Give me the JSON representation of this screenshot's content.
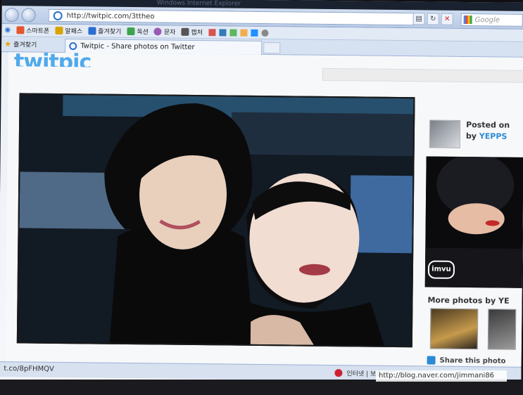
{
  "browser": {
    "title_text": "Windows Internet Explorer",
    "url": "http://twitpic.com/3ttheo",
    "search_placeholder": "Google",
    "links": [
      {
        "label": "스마트폰",
        "icon": "home-icon",
        "color": "#e4572e"
      },
      {
        "label": "알패스",
        "icon": "key-icon",
        "color": "#d9a400"
      },
      {
        "label": "즐겨찾기",
        "icon": "star-icon",
        "color": "#2a6fd0"
      },
      {
        "label": "옥션",
        "icon": "auction-icon",
        "color": "#3fa34d"
      },
      {
        "label": "문자",
        "icon": "chat-icon",
        "color": "#9b59b6"
      },
      {
        "label": "캡처",
        "icon": "capture-icon",
        "color": "#555555"
      }
    ],
    "favorites_label": "즐겨찾기",
    "tab_title": "Twitpic - Share photos on Twitter",
    "status_url": "t.co/8pFHMQV",
    "status_zone": "인터넷 | 보호 모드: 켜짐"
  },
  "page": {
    "logo_text": "twitpic",
    "posted_on": "Posted on",
    "by_label": "by",
    "username": "YEPPS",
    "more_photos": "More photos by YE",
    "share_label": "Share this photo",
    "ad_brand": "imvu"
  },
  "watermark": "http://blog.naver.com/jimmani86",
  "colors": {
    "accent": "#2b8ad6",
    "logo": "#4fa9ec"
  }
}
